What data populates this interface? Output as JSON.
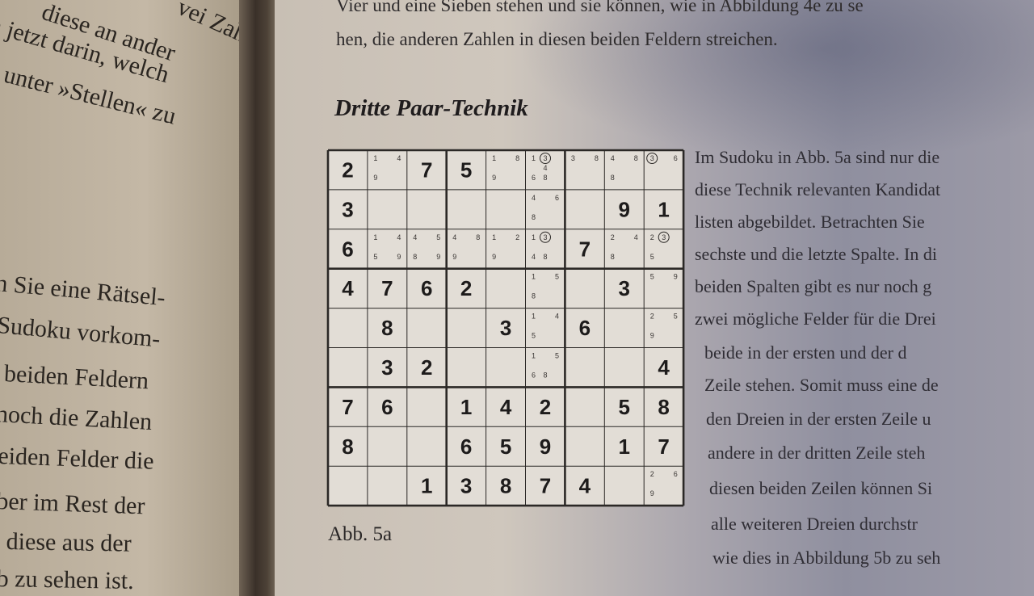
{
  "left_page": {
    "lines": [
      "vei Zah",
      "diese an ander",
      "h jetzt darin, welch",
      "l unter »Stellen« zu",
      "n Sie eine Rätsel-",
      "Sudoku vorkom-",
      "beiden Feldern",
      "noch die Zahlen",
      "eiden Felder die",
      "ber im Rest der",
      "diese aus der",
      "b zu sehen ist."
    ]
  },
  "right_page": {
    "top_lines": [
      "Vier und eine Sieben stehen und sie können, wie in Abbildung 4e zu se",
      "hen, die anderen Zahlen in diesen beiden Feldern streichen."
    ],
    "heading": "Dritte Paar-Technik",
    "caption": "Abb. 5a",
    "body_lines": [
      "Im Sudoku in Abb. 5a sind nur die",
      "diese Technik relevanten Kandidat",
      "listen abgebildet. Betrachten Sie",
      "sechste und die letzte Spalte. In di",
      "beiden Spalten gibt es nur noch g",
      "zwei mögliche Felder für die Drei",
      "beide in der ersten und der d",
      "Zeile stehen. Somit muss eine de",
      "den Dreien in der ersten Zeile u",
      "andere in der dritten Zeile steh",
      "diesen beiden Zeilen können Si",
      "alle weiteren Dreien durchstr",
      "wie dies in Abbildung 5b zu seh"
    ]
  },
  "sudoku": {
    "rows": [
      [
        "2",
        "",
        "7",
        "5",
        "",
        "",
        "",
        "",
        ""
      ],
      [
        "3",
        "",
        "",
        "",
        "",
        "",
        "",
        "9",
        "1"
      ],
      [
        "6",
        "",
        "",
        "",
        "",
        "",
        "7",
        "",
        ""
      ],
      [
        "4",
        "7",
        "6",
        "2",
        "",
        "",
        "",
        "3",
        ""
      ],
      [
        "",
        "8",
        "",
        "",
        "3",
        "",
        "6",
        "",
        ""
      ],
      [
        "",
        "3",
        "2",
        "",
        "",
        "",
        "",
        "",
        "4"
      ],
      [
        "7",
        "6",
        "",
        "1",
        "4",
        "2",
        "",
        "5",
        "8"
      ],
      [
        "8",
        "",
        "",
        "6",
        "5",
        "9",
        "",
        "1",
        "7"
      ],
      [
        "",
        "",
        "1",
        "3",
        "8",
        "7",
        "4",
        "",
        ""
      ]
    ],
    "candidates": [
      {
        "r": 0,
        "c": 1,
        "v": [
          "1",
          "",
          "4",
          "",
          "",
          "",
          "9",
          "",
          ""
        ]
      },
      {
        "r": 0,
        "c": 4,
        "v": [
          "1",
          "",
          "8",
          "",
          "",
          "",
          "9",
          "",
          ""
        ]
      },
      {
        "r": 0,
        "c": 5,
        "v": [
          "1",
          "3",
          "",
          "",
          "4",
          "",
          "6",
          "8",
          ""
        ]
      },
      {
        "r": 0,
        "c": 6,
        "v": [
          "3",
          "",
          "8",
          "",
          "",
          "",
          "",
          "",
          ""
        ]
      },
      {
        "r": 0,
        "c": 7,
        "v": [
          "4",
          "",
          "8",
          "",
          "",
          "",
          "8",
          "",
          ""
        ]
      },
      {
        "r": 0,
        "c": 8,
        "v": [
          "3",
          "",
          "6",
          "",
          "",
          "",
          "",
          "",
          ""
        ]
      },
      {
        "r": 1,
        "c": 5,
        "v": [
          "4",
          "",
          "6",
          "",
          "",
          "",
          "8",
          "",
          ""
        ]
      },
      {
        "r": 2,
        "c": 1,
        "v": [
          "1",
          "",
          "4",
          "",
          "",
          "",
          "5",
          "",
          "9"
        ]
      },
      {
        "r": 2,
        "c": 2,
        "v": [
          "4",
          "",
          "5",
          "",
          "",
          "",
          "8",
          "",
          "9"
        ]
      },
      {
        "r": 2,
        "c": 3,
        "v": [
          "4",
          "",
          "8",
          "",
          "",
          "",
          "9",
          "",
          ""
        ]
      },
      {
        "r": 2,
        "c": 4,
        "v": [
          "1",
          "",
          "2",
          "",
          "",
          "",
          "9",
          "",
          ""
        ]
      },
      {
        "r": 2,
        "c": 5,
        "v": [
          "1",
          "3",
          "",
          "",
          "",
          "",
          "4",
          "8",
          ""
        ]
      },
      {
        "r": 2,
        "c": 7,
        "v": [
          "2",
          "",
          "4",
          "",
          "",
          "",
          "8",
          "",
          ""
        ]
      },
      {
        "r": 2,
        "c": 8,
        "v": [
          "2",
          "3",
          "",
          "",
          "",
          "",
          "5",
          "",
          ""
        ]
      },
      {
        "r": 3,
        "c": 5,
        "v": [
          "1",
          "",
          "5",
          "",
          "",
          "",
          "8",
          "",
          ""
        ]
      },
      {
        "r": 3,
        "c": 8,
        "v": [
          "5",
          "",
          "9",
          "",
          "",
          "",
          "",
          "",
          ""
        ]
      },
      {
        "r": 4,
        "c": 5,
        "v": [
          "1",
          "",
          "4",
          "",
          "",
          "",
          "5",
          "",
          ""
        ]
      },
      {
        "r": 4,
        "c": 8,
        "v": [
          "2",
          "",
          "5",
          "",
          "",
          "",
          "9",
          "",
          ""
        ]
      },
      {
        "r": 5,
        "c": 5,
        "v": [
          "1",
          "",
          "5",
          "",
          "",
          "",
          "6",
          "8",
          ""
        ]
      },
      {
        "r": 8,
        "c": 8,
        "v": [
          "2",
          "",
          "6",
          "",
          "",
          "",
          "9",
          "",
          ""
        ]
      }
    ],
    "circled": [
      {
        "r": 0,
        "c": 5,
        "i": 1
      },
      {
        "r": 0,
        "c": 8,
        "i": 0
      },
      {
        "r": 2,
        "c": 5,
        "i": 1
      },
      {
        "r": 2,
        "c": 8,
        "i": 1
      }
    ]
  }
}
